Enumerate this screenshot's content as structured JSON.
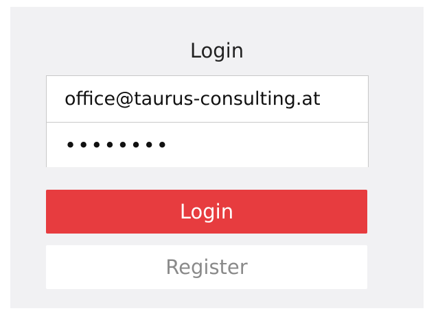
{
  "login_form": {
    "title": "Login",
    "email_value": "office@taurus-consulting.at",
    "password_value": "password",
    "login_button": "Login",
    "register_button": "Register"
  },
  "colors": {
    "panel_bg": "#f1f1f3",
    "login_button_bg": "#e73c3f",
    "register_text": "#8a8a8a"
  }
}
